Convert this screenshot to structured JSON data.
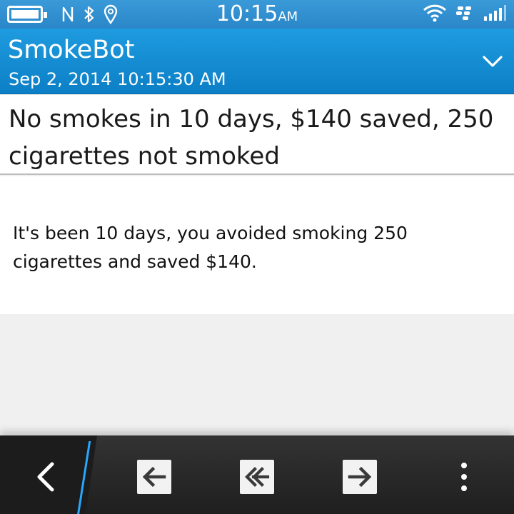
{
  "status_bar": {
    "time": "10:15",
    "ampm": "AM",
    "icons": [
      "battery-icon",
      "nfc-icon",
      "bluetooth-icon",
      "location-icon",
      "wifi-icon",
      "bbm-icon",
      "signal-icon"
    ]
  },
  "header": {
    "title": "SmokeBot",
    "subtitle": "Sep 2, 2014 10:15:30 AM"
  },
  "message": {
    "subject": "No smokes in 10 days, $140 saved, 250 cigarettes not smoked",
    "body": "It's been 10 days, you avoided smoking 250 cigarettes and saved $140."
  },
  "action_bar": {
    "buttons": [
      "back-icon",
      "reply-icon",
      "reply-all-icon",
      "forward-icon",
      "more-icon"
    ]
  },
  "colors": {
    "accent": "#0c7fc6",
    "status_bar": "#2f8fd0",
    "action_bar": "#2a2a2a",
    "active_edge": "#29a7ff"
  }
}
